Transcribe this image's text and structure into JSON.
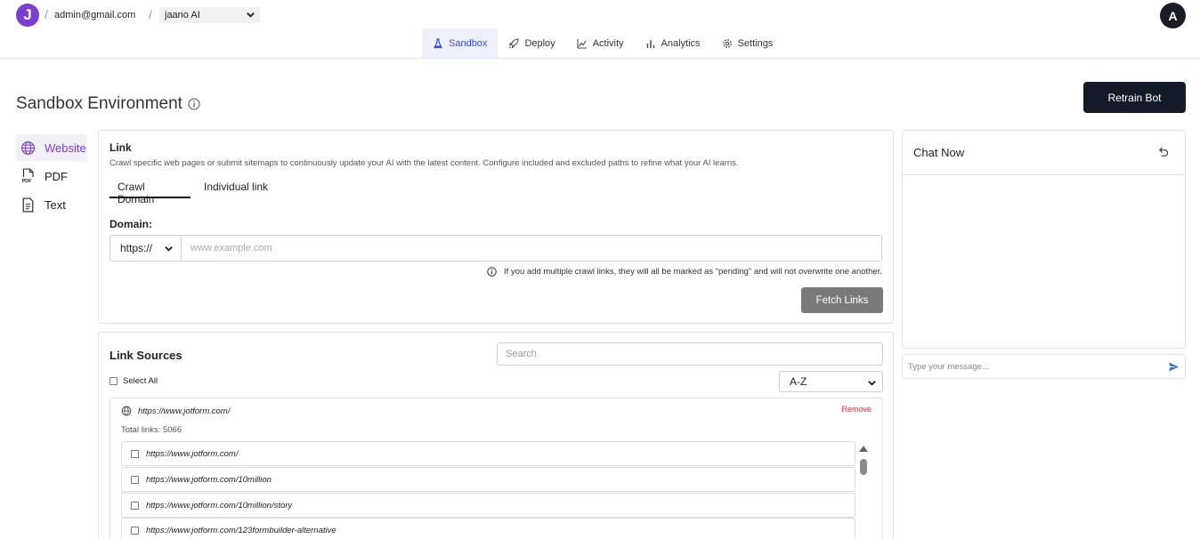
{
  "header": {
    "logo_letter": "J",
    "email": "admin@gmail.com",
    "bot_selected": "jaano AI",
    "avatar_letter": "A"
  },
  "nav": {
    "items": [
      {
        "label": "Sandbox",
        "icon": "flask-icon",
        "active": true
      },
      {
        "label": "Deploy",
        "icon": "rocket-icon"
      },
      {
        "label": "Activity",
        "icon": "activity-chart-icon"
      },
      {
        "label": "Analytics",
        "icon": "bar-chart-icon"
      },
      {
        "label": "Settings",
        "icon": "gear-icon"
      }
    ]
  },
  "page": {
    "title": "Sandbox Environment",
    "retrain_label": "Retrain Bot"
  },
  "sources_nav": {
    "items": [
      {
        "label": "Website",
        "icon": "globe-icon",
        "active": true
      },
      {
        "label": "PDF",
        "icon": "pdf-icon"
      },
      {
        "label": "Text",
        "icon": "document-icon"
      }
    ]
  },
  "link_card": {
    "title": "Link",
    "description": "Crawl specific web pages or submit sitemaps to continuously update your AI with the latest content. Configure included and excluded paths to refine what your AI learns.",
    "tabs": [
      "Crawl Domain",
      "Individual link"
    ],
    "active_tab": "Crawl Domain",
    "domain_label": "Domain:",
    "protocol": "https://",
    "domain_placeholder": "www.example.com",
    "note": "If you add multiple crawl links, they will all be marked as \"pending\" and will not overwrite one another.",
    "fetch_label": "Fetch Links"
  },
  "sources_card": {
    "title": "Link Sources",
    "search_placeholder": "Search",
    "select_all_label": "Select All",
    "sort_value": "A-Z",
    "source": {
      "url": "https://www.jotform.com/",
      "remove_label": "Remove",
      "total_links": "Total links: 5066",
      "links": [
        "https://www.jotform.com/",
        "https://www.jotform.com/10million",
        "https://www.jotform.com/10million/story",
        "https://www.jotform.com/123formbuilder-alternative"
      ]
    }
  },
  "chat": {
    "title": "Chat Now",
    "input_placeholder": "Type your message..."
  },
  "colors": {
    "brand": "#7a3fd0",
    "nav_active": "#3b4bd6",
    "primary_button": "#151a28",
    "fetch_button": "#7a7a7a",
    "send_icon": "#3b6fd6"
  }
}
